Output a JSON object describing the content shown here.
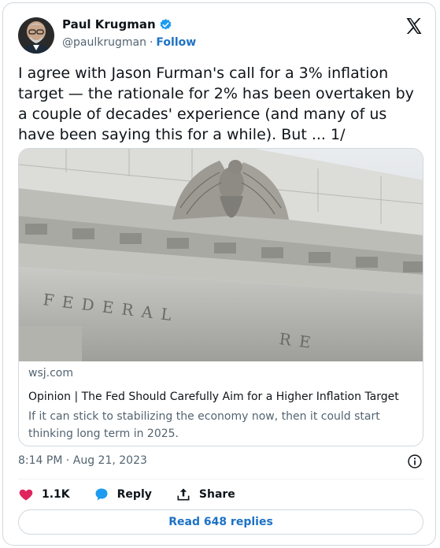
{
  "author": {
    "name": "Paul Krugman",
    "handle": "@paulkrugman",
    "separator": "·",
    "follow_label": "Follow"
  },
  "tweet": {
    "text": "I agree with Jason Furman's call for a 3% inflation target — the rationale for 2% has been overtaken by a couple of decades' experience (and many of us have been saying this for a while). But ... 1/"
  },
  "link_card": {
    "domain": "wsj.com",
    "title": "Opinion | The Fed Should Carefully Aim for a Higher Inflation Target",
    "description": "If it can stick to stabilizing the economy now, then it could start thinking long term in 2025.",
    "image_inscription": "FEDERAL RE"
  },
  "meta": {
    "timestamp": "8:14 PM · Aug 21, 2023"
  },
  "actions": {
    "likes_count": "1.1K",
    "reply_label": "Reply",
    "share_label": "Share"
  },
  "replies": {
    "button_label": "Read 648 replies"
  },
  "colors": {
    "accent": "#1d72c4",
    "like": "#e0245e",
    "verified": "#1d9bf0",
    "muted_text": "#536471"
  },
  "icons": {
    "verified": "verified-badge-icon",
    "x_logo": "x-logo-icon",
    "info": "info-icon",
    "like": "heart-icon",
    "reply": "reply-bubble-icon",
    "share": "share-upload-icon"
  }
}
